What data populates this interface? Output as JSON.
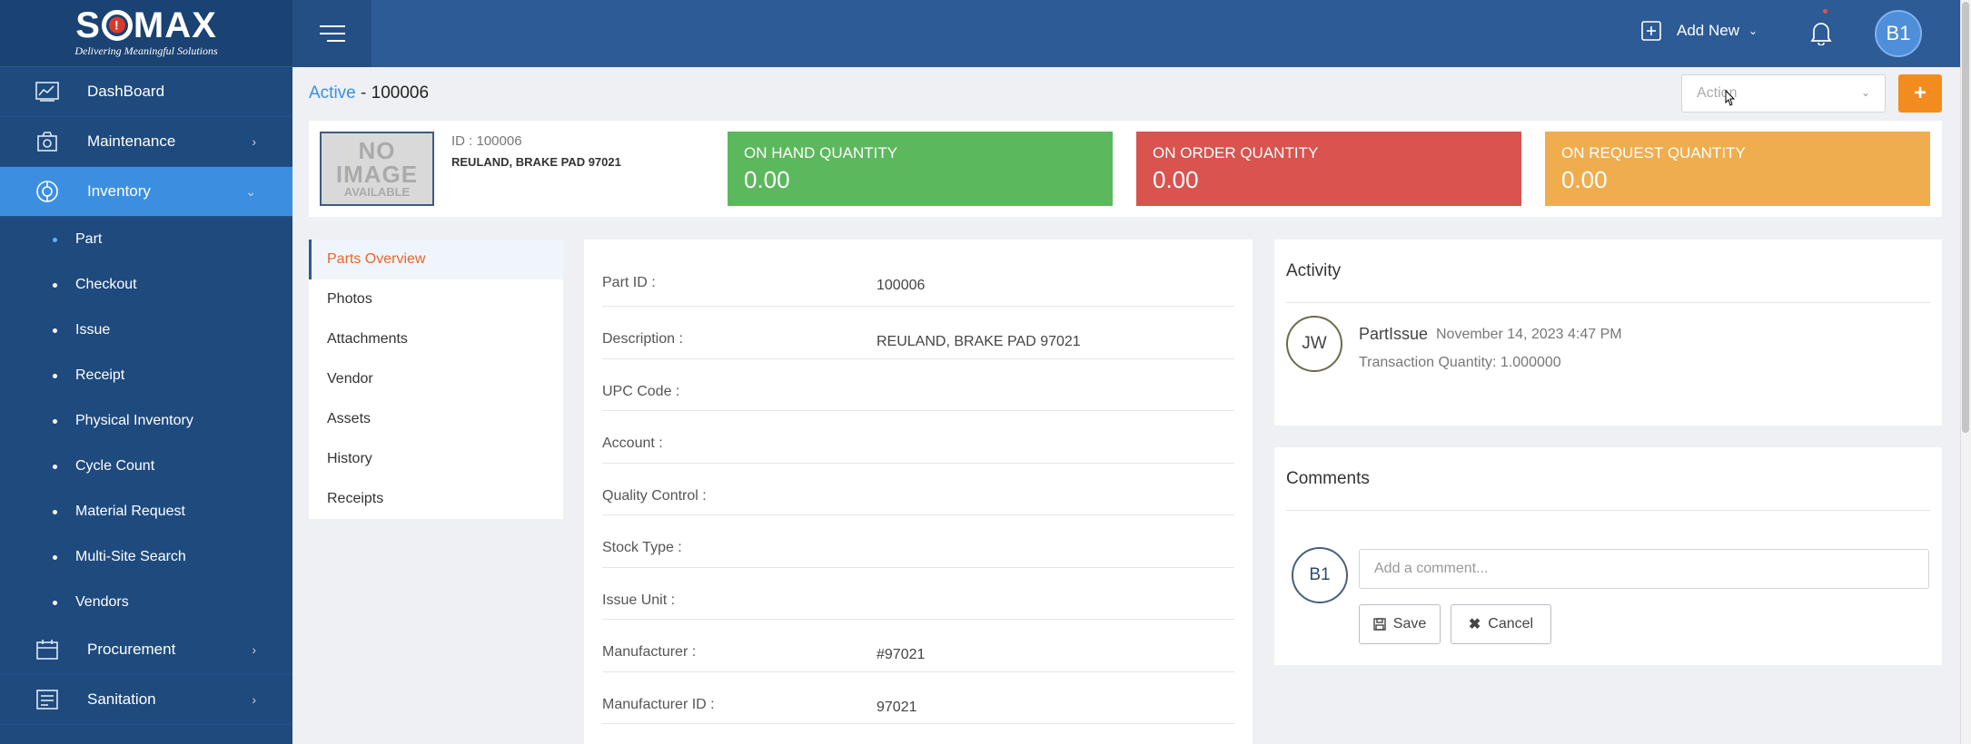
{
  "brand": {
    "name_pre": "S",
    "name_post": "MAX",
    "tagline": "Delivering Meaningful Solutions"
  },
  "sidebar": {
    "items": [
      {
        "label": "DashBoard",
        "icon": "dashboard-chart-icon"
      },
      {
        "label": "Maintenance",
        "icon": "maintenance-icon"
      },
      {
        "label": "Inventory",
        "icon": "inventory-icon"
      },
      {
        "label": "Procurement",
        "icon": "procurement-icon"
      },
      {
        "label": "Sanitation",
        "icon": "sanitation-icon"
      }
    ],
    "inventory_sub": [
      "Part",
      "Checkout",
      "Issue",
      "Receipt",
      "Physical Inventory",
      "Cycle Count",
      "Material Request",
      "Multi-Site Search",
      "Vendors"
    ]
  },
  "topbar": {
    "add_new": "Add New",
    "avatar": "B1"
  },
  "header": {
    "status": "Active",
    "separator": " - ",
    "part_id": "100006",
    "action_placeholder": "Action",
    "plus": "+"
  },
  "summary": {
    "noimage": [
      "NO",
      "IMAGE",
      "AVAILABLE"
    ],
    "id_line": "ID : 100006",
    "description": "REULAND, BRAKE PAD 97021",
    "on_hand": {
      "label": "ON HAND QUANTITY",
      "value": "0.00"
    },
    "on_order": {
      "label": "ON ORDER QUANTITY",
      "value": "0.00"
    },
    "on_request": {
      "label": "ON REQUEST QUANTITY",
      "value": "0.00"
    }
  },
  "tabs": [
    "Parts Overview",
    "Photos",
    "Attachments",
    "Vendor",
    "Assets",
    "History",
    "Receipts"
  ],
  "details": [
    {
      "label": "Part ID :",
      "value": "100006"
    },
    {
      "label": "Description :",
      "value": "REULAND, BRAKE PAD 97021"
    },
    {
      "label": "UPC Code :",
      "value": ""
    },
    {
      "label": "Account :",
      "value": ""
    },
    {
      "label": "Quality Control :",
      "value": ""
    },
    {
      "label": "Stock Type :",
      "value": ""
    },
    {
      "label": "Issue Unit :",
      "value": ""
    },
    {
      "label": "Manufacturer :",
      "value": "#97021"
    },
    {
      "label": "Manufacturer ID :",
      "value": "97021"
    }
  ],
  "activity": {
    "title": "Activity",
    "avatar": "JW",
    "name": "PartIssue",
    "date": "November 14, 2023 4:47 PM",
    "detail": "Transaction Quantity: 1.000000"
  },
  "comments": {
    "title": "Comments",
    "avatar": "B1",
    "placeholder": "Add a comment...",
    "save": "Save",
    "cancel": "Cancel"
  },
  "colors": {
    "sidebar": "#1e4a7e",
    "topbar": "#2c5b96",
    "active_nav": "#3c8fe0",
    "green": "#5cb85c",
    "red": "#d9534f",
    "orange": "#f0ad4e",
    "accent": "#f28c1f"
  }
}
